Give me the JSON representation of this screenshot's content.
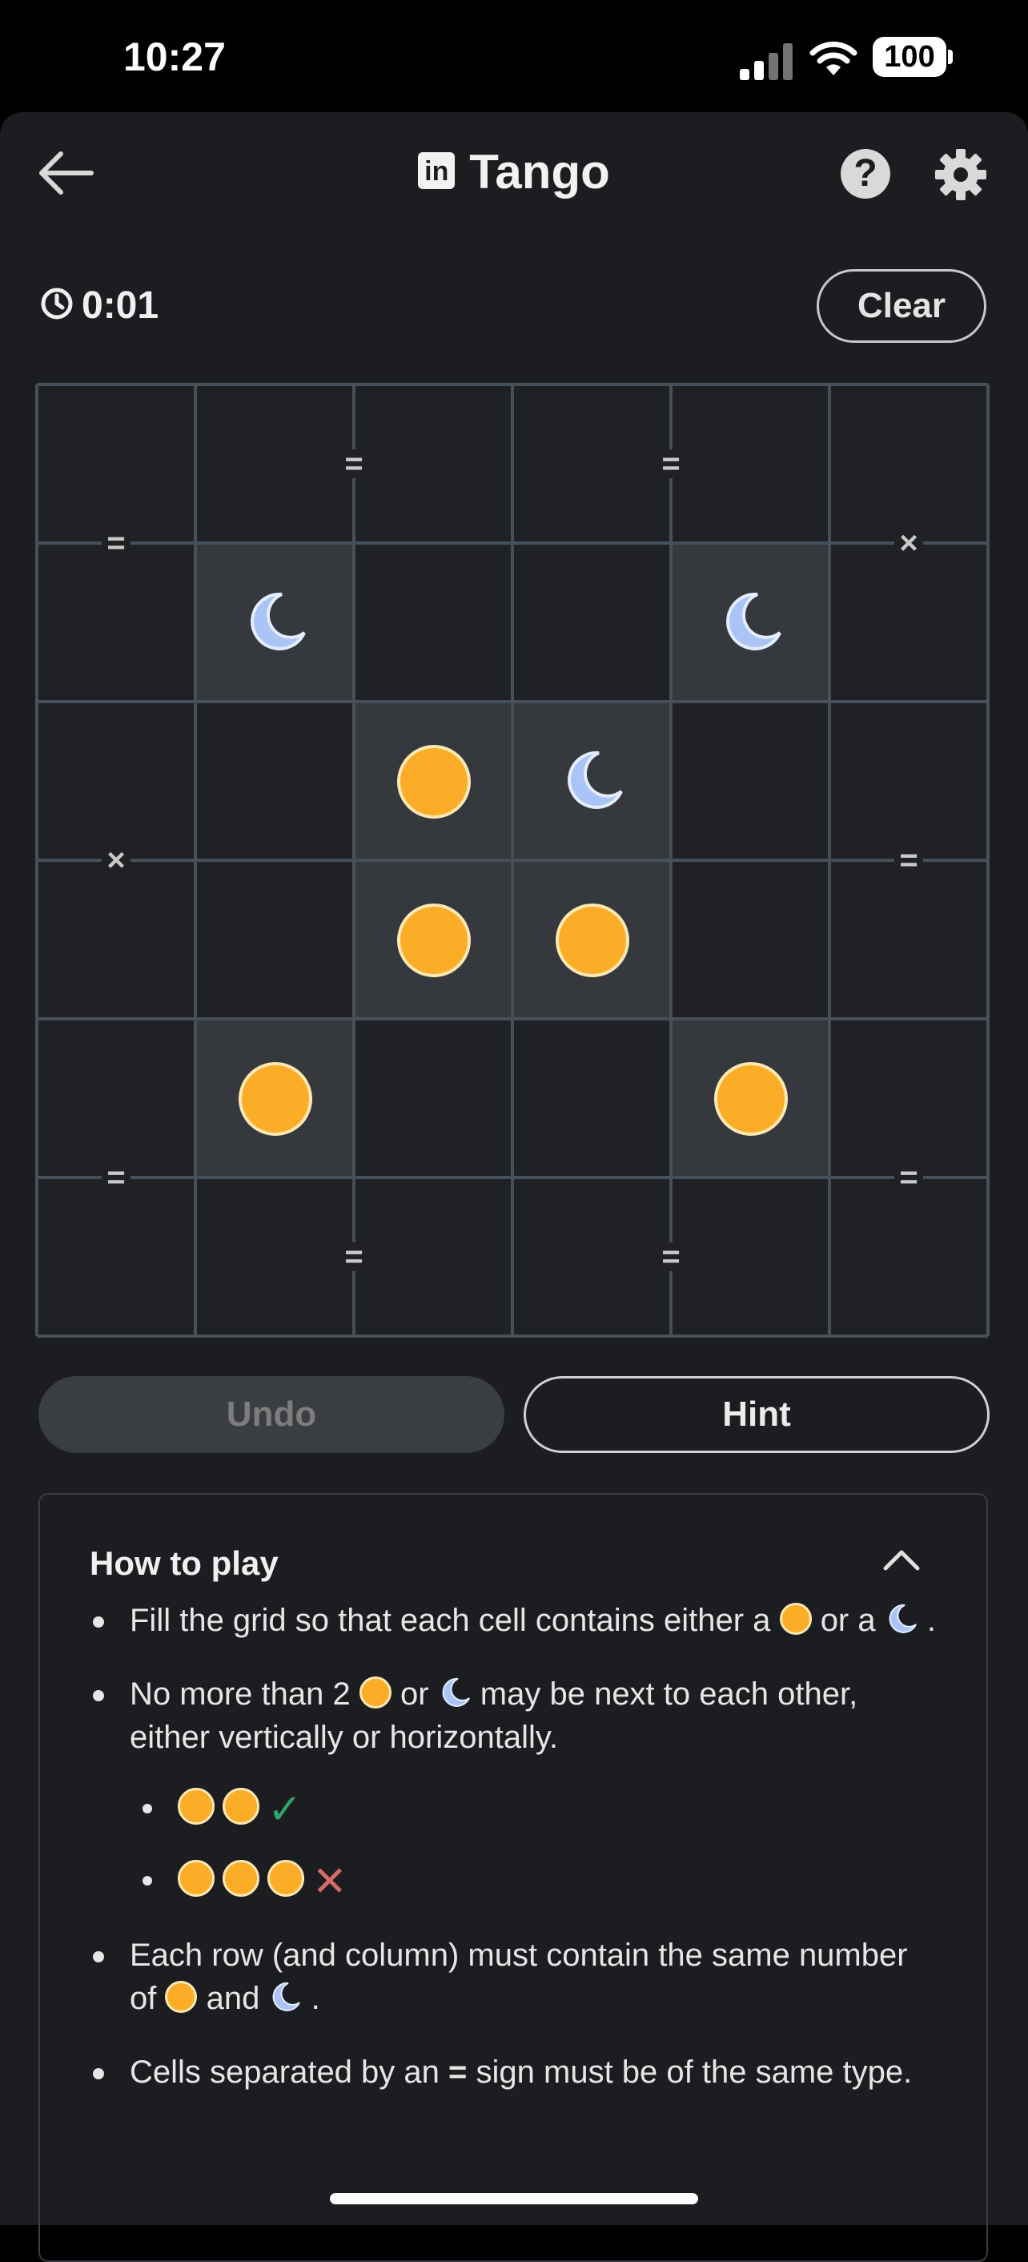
{
  "status": {
    "time": "10:27",
    "battery": "100"
  },
  "header": {
    "title": "Tango",
    "logo_text": "in",
    "help_symbol": "?"
  },
  "timer": {
    "value": "0:01"
  },
  "buttons": {
    "clear": "Clear",
    "undo": "Undo",
    "hint": "Hint"
  },
  "colors": {
    "sun": "#fbad27",
    "moon": "#a9c4f5",
    "locked_cell": "#35383c",
    "check": "#2fa36b",
    "cross": "#d56a6a"
  },
  "grid": {
    "size": 6,
    "cells": [
      [
        null,
        null,
        null,
        null,
        null,
        null
      ],
      [
        null,
        "moon",
        null,
        null,
        "moon",
        null
      ],
      [
        null,
        null,
        "sun",
        "moon",
        null,
        null
      ],
      [
        null,
        null,
        "sun",
        "sun",
        null,
        null
      ],
      [
        null,
        "sun",
        null,
        null,
        "sun",
        null
      ],
      [
        null,
        null,
        null,
        null,
        null,
        null
      ]
    ],
    "locked": [
      [
        1,
        1
      ],
      [
        1,
        4
      ],
      [
        2,
        2
      ],
      [
        2,
        3
      ],
      [
        3,
        2
      ],
      [
        3,
        3
      ],
      [
        4,
        1
      ],
      [
        4,
        4
      ]
    ],
    "constraints": [
      {
        "between": [
          [
            0,
            1
          ],
          [
            0,
            2
          ]
        ],
        "type": "="
      },
      {
        "between": [
          [
            0,
            3
          ],
          [
            0,
            4
          ]
        ],
        "type": "="
      },
      {
        "between": [
          [
            0,
            0
          ],
          [
            1,
            0
          ]
        ],
        "type": "="
      },
      {
        "between": [
          [
            0,
            5
          ],
          [
            1,
            5
          ]
        ],
        "type": "×"
      },
      {
        "between": [
          [
            2,
            0
          ],
          [
            3,
            0
          ]
        ],
        "type": "×"
      },
      {
        "between": [
          [
            2,
            5
          ],
          [
            3,
            5
          ]
        ],
        "type": "="
      },
      {
        "between": [
          [
            4,
            0
          ],
          [
            5,
            0
          ]
        ],
        "type": "="
      },
      {
        "between": [
          [
            4,
            5
          ],
          [
            5,
            5
          ]
        ],
        "type": "="
      },
      {
        "between": [
          [
            5,
            1
          ],
          [
            5,
            2
          ]
        ],
        "type": "="
      },
      {
        "between": [
          [
            5,
            3
          ],
          [
            5,
            4
          ]
        ],
        "type": "="
      }
    ]
  },
  "how_to_play": {
    "title": "How to play",
    "rule1": {
      "a": "Fill the grid so that each cell contains either a",
      "b": "or a",
      "c": "."
    },
    "rule2": {
      "a": "No more than 2",
      "b": "or",
      "c": "may be next to each other, either vertically or horizontally."
    },
    "rule2_ok": "✓",
    "rule2_bad": "✕",
    "rule3": {
      "a": "Each row (and column) must contain the same number of",
      "b": "and",
      "c": "."
    },
    "rule4": {
      "a": "Cells separated by an",
      "sign": "=",
      "b": "sign must be of the same type."
    }
  }
}
